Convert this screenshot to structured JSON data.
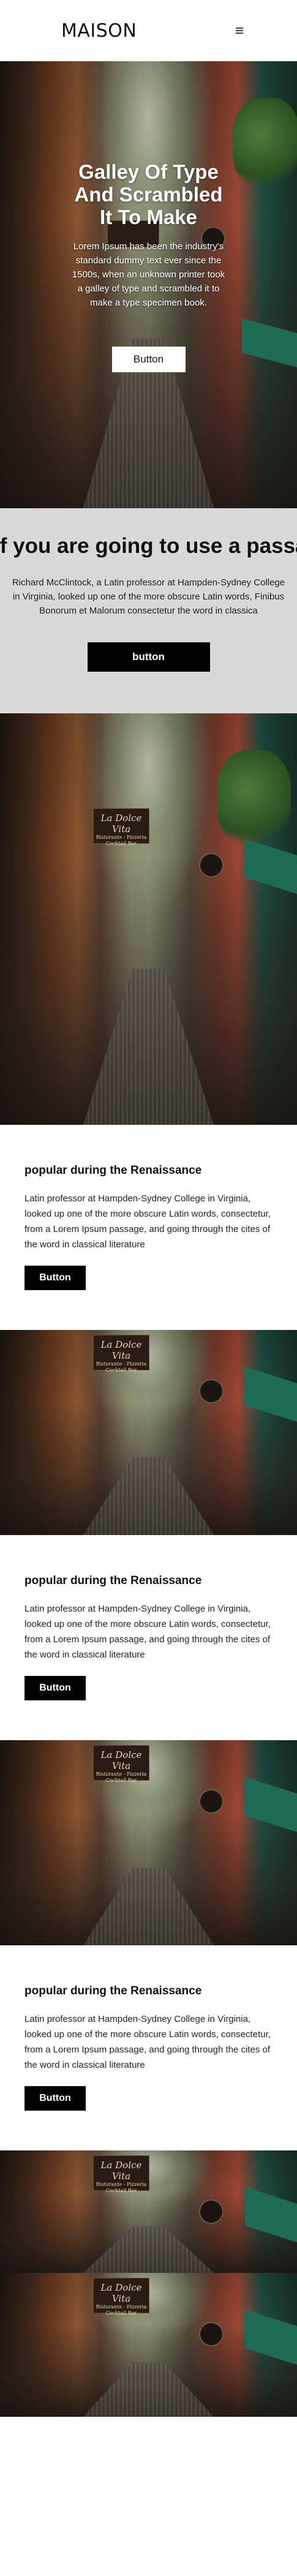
{
  "header": {
    "brand": "MAISON",
    "menu_icon": "menu-icon"
  },
  "hero": {
    "title": "Galley Of Type And Scrambled It To Make",
    "text": "Lorem Ipsum has been the industry's standard dummy text ever since the 1500s, when an unknown printer took a galley of type and scrambled it to make a type specimen book.",
    "button_label": "Button"
  },
  "passage": {
    "title": "If you are going to use a passage",
    "text_line1": "Richard McClintock, a Latin professor at Hampden-Sydney College",
    "text_line2": "in Virginia, looked up one of the more obscure Latin words, Finibus",
    "text_line3": "Bonorum et Malorum consectetur the word in classica",
    "button_label": "button"
  },
  "sign": {
    "title": "La Dolce Vita",
    "sub1": "Ristorante - Pizzeria",
    "sub2": "Cocktail Bar"
  },
  "sections": [
    {
      "title": "popular during the Renaissance",
      "text": "Latin professor at Hampden-Sydney College in Virginia, looked up one of the more obscure Latin words, consectetur, from a Lorem Ipsum passage, and going through the cites of the word in classical literature",
      "button_label": "Button"
    },
    {
      "title": "popular during the Renaissance",
      "text": "Latin professor at Hampden-Sydney College in Virginia, looked up one of the more obscure Latin words, consectetur, from a Lorem Ipsum passage, and going through the cites of the word in classical literature",
      "button_label": "Button"
    },
    {
      "title": "popular during the Renaissance",
      "text": "Latin professor at Hampden-Sydney College in Virginia, looked up one of the more obscure Latin words, consectetur, from a Lorem Ipsum passage, and going through the cites of the word in classical literature",
      "button_label": "Button"
    }
  ],
  "colors": {
    "passage_bg": "#d9d9d9",
    "button_dark": "#000000",
    "button_light": "#ffffff"
  }
}
